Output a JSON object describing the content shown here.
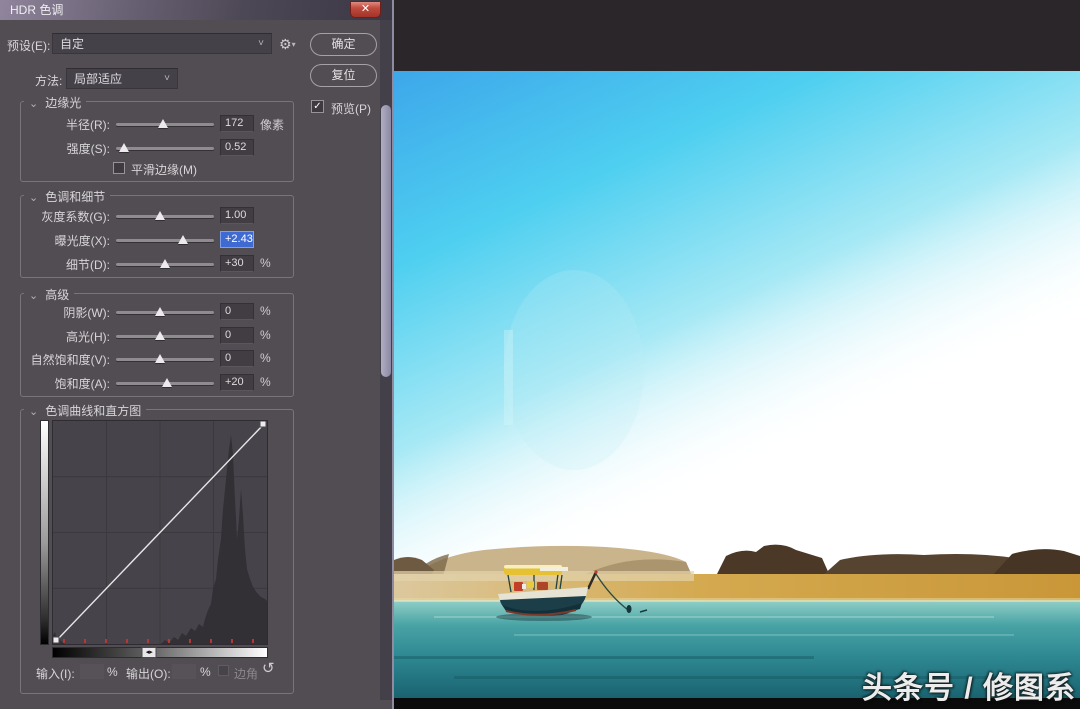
{
  "dialog": {
    "title": "HDR 色调",
    "preset_label": "预设(E):",
    "preset_value": "自定",
    "method_label": "方法:",
    "method_value": "局部适应",
    "ok_label": "确定",
    "reset_label": "复位",
    "preview_label": "预览(P)",
    "sections": {
      "edge_glow": {
        "title": "边缘光",
        "rows": [
          {
            "label": "半径(R):",
            "value": "172",
            "unit": "像素",
            "thumb": 48
          },
          {
            "label": "强度(S):",
            "value": "0.52",
            "unit": "",
            "thumb": 8
          }
        ],
        "smooth_label": "平滑边缘(M)"
      },
      "tone_detail": {
        "title": "色调和细节",
        "rows": [
          {
            "label": "灰度系数(G):",
            "value": "1.00",
            "unit": "",
            "thumb": 45
          },
          {
            "label": "曝光度(X):",
            "value": "+2.43",
            "unit": "",
            "thumb": 68
          },
          {
            "label": "细节(D):",
            "value": "+30",
            "unit": "%",
            "thumb": 50
          }
        ]
      },
      "advanced": {
        "title": "高级",
        "rows": [
          {
            "label": "阴影(W):",
            "value": "0",
            "unit": "%",
            "thumb": 45
          },
          {
            "label": "高光(H):",
            "value": "0",
            "unit": "%",
            "thumb": 45
          },
          {
            "label": "自然饱和度(V):",
            "value": "0",
            "unit": "%",
            "thumb": 45
          },
          {
            "label": "饱和度(A):",
            "value": "+20",
            "unit": "%",
            "thumb": 52
          }
        ]
      },
      "curve": {
        "title": "色调曲线和直方图",
        "input_label": "输入(I):",
        "input_unit": "%",
        "output_label": "输出(O):",
        "output_unit": "%",
        "corner_label": "边角",
        "gradient_handle_pct": 45
      }
    }
  },
  "canvas": {
    "watermark": "头条号 / 修图系"
  },
  "icons": {
    "close": "✕",
    "gear": "⚙",
    "gear_drop": "▾",
    "combo_chevron": "˅",
    "section_chevron": "⌄",
    "check": "✓",
    "reset_curve": "↺",
    "gradient_arrows": "◂▸"
  },
  "colors": {
    "selection_blue": "#3F6AD1",
    "dialog_bg": "#514D52",
    "accent_red_close": "#c04b3e"
  }
}
